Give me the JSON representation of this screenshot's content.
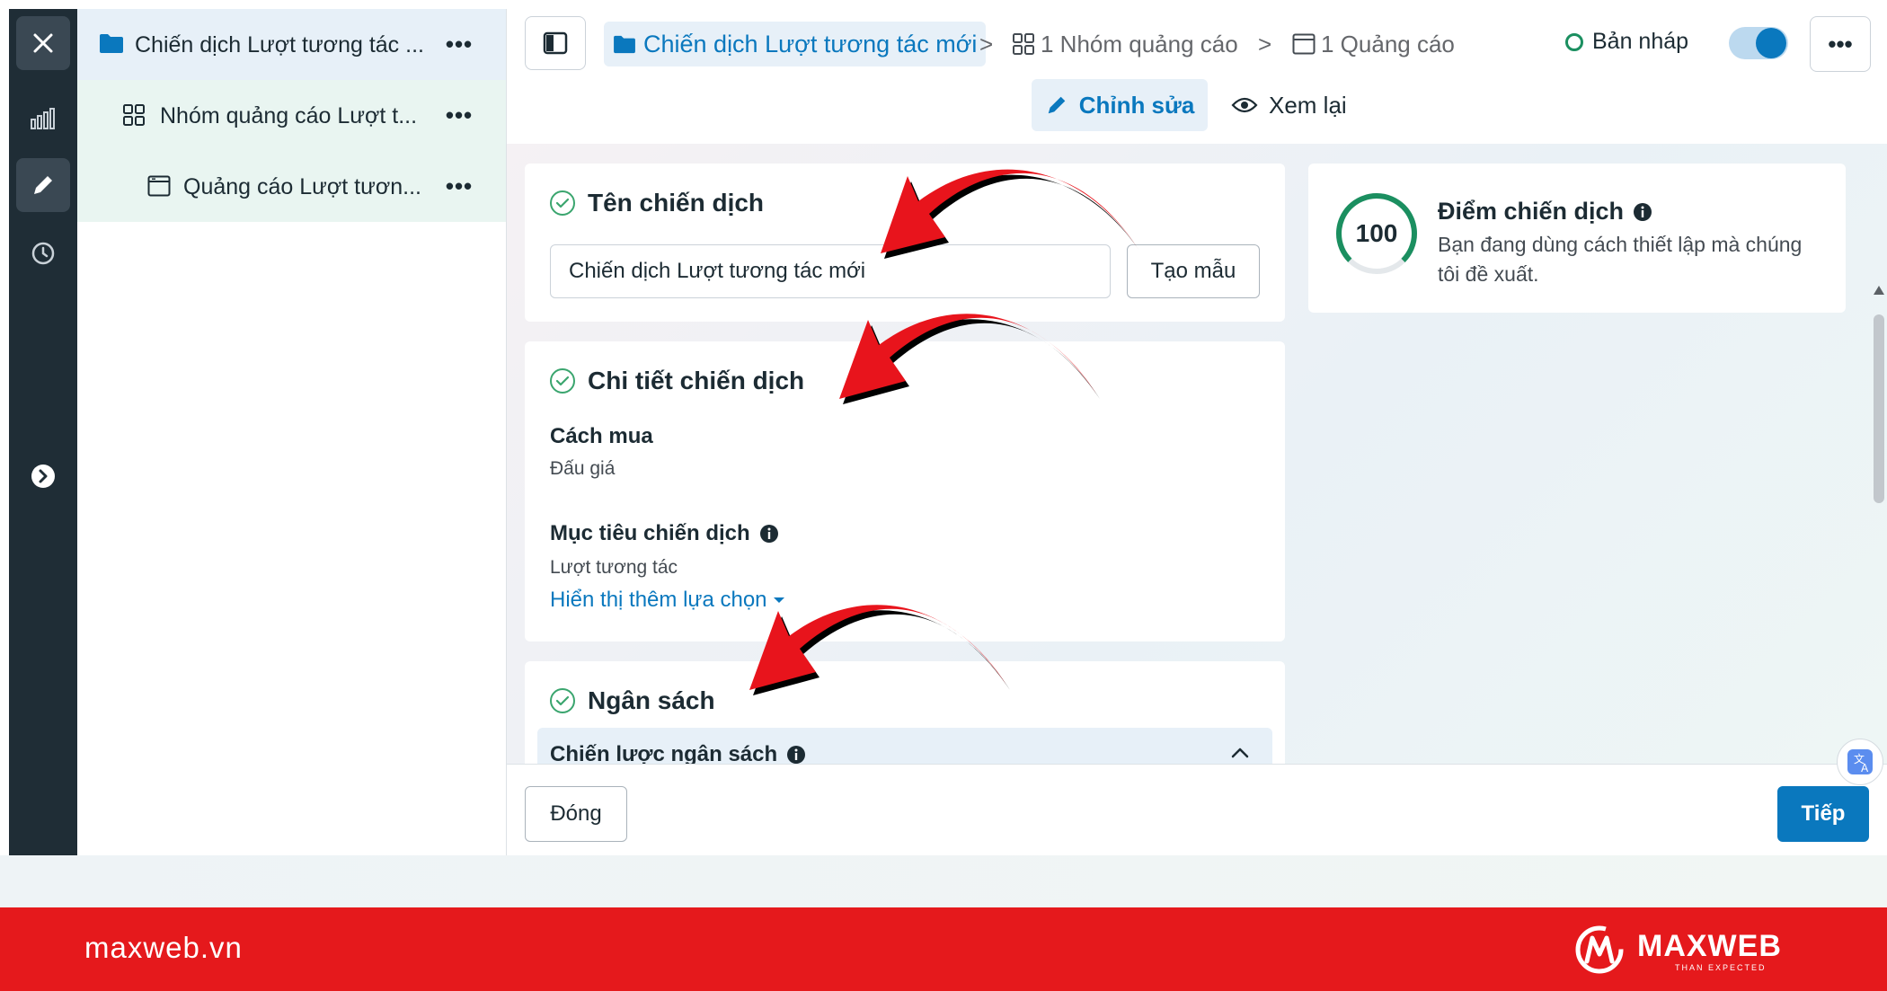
{
  "sidebar": {
    "close_icon": "close-icon",
    "stats_icon": "bar-chart-icon",
    "edit_icon": "pencil-icon",
    "history_icon": "clock-icon",
    "expand_icon": "chevron-right-circle-icon"
  },
  "tree": {
    "items": [
      {
        "label": "Chiến dịch Lượt tương tác ...",
        "icon": "folder-icon"
      },
      {
        "label": "Nhóm quảng cáo Lượt t...",
        "icon": "grid-icon"
      },
      {
        "label": "Quảng cáo Lượt tươn...",
        "icon": "ad-frame-icon"
      }
    ],
    "more_label": "•••"
  },
  "header": {
    "breadcrumb_campaign": "Chiến dịch Lượt tương tác mới",
    "breadcrumb_adset": "1 Nhóm quảng cáo",
    "breadcrumb_ad": "1 Quảng cáo",
    "separator": ">",
    "status": "Bản nháp",
    "menu_label": "•••",
    "mode_edit": "Chỉnh sửa",
    "mode_review": "Xem lại"
  },
  "campaign_name_card": {
    "title": "Tên chiến dịch",
    "input_value": "Chiến dịch Lượt tương tác mới",
    "template_button": "Tạo mẫu"
  },
  "campaign_details_card": {
    "title": "Chi tiết chiến dịch",
    "buying_label": "Cách mua",
    "buying_value": "Đấu giá",
    "objective_label": "Mục tiêu chiến dịch",
    "objective_value": "Lượt tương tác",
    "more_options": "Hiển thị thêm lựa chọn"
  },
  "budget_card": {
    "title": "Ngân sách",
    "strategy_label": "Chiến lược ngân sách"
  },
  "score_card": {
    "score": "100",
    "score_fraction": 1.0,
    "title": "Điểm chiến dịch",
    "description": "Bạn đang dùng cách thiết lập mà chúng tôi đề xuất."
  },
  "footer": {
    "close_button": "Đóng",
    "next_button": "Tiếp"
  },
  "brand": {
    "url": "maxweb.vn",
    "name": "MAXWEB",
    "tagline": "THAN EXPECTED"
  },
  "colors": {
    "accent": "#0a78be",
    "success": "#3aa56e",
    "brand_red": "#e5191c",
    "annotation_arrow": "#e8141c"
  }
}
